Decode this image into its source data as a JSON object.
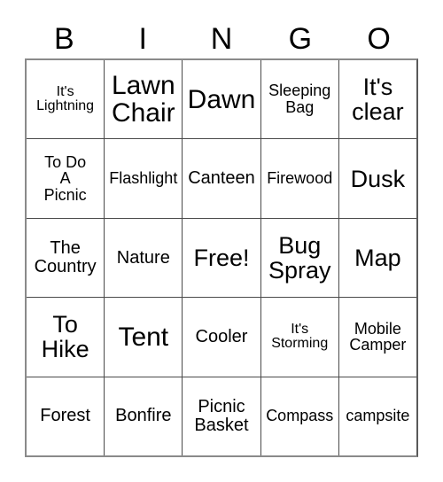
{
  "card": {
    "title_letters": [
      "B",
      "I",
      "N",
      "G",
      "O"
    ],
    "rows": [
      [
        {
          "text": "It's\nLightning",
          "size": "sz-s"
        },
        {
          "text": "Lawn\nChair",
          "size": "sz-xxl"
        },
        {
          "text": "Dawn",
          "size": "sz-xxl"
        },
        {
          "text": "Sleeping\nBag",
          "size": "sz-m"
        },
        {
          "text": "It's\nclear",
          "size": "sz-xl"
        }
      ],
      [
        {
          "text": "To Do\nA\nPicnic",
          "size": "sz-m"
        },
        {
          "text": "Flashlight",
          "size": "sz-m"
        },
        {
          "text": "Canteen",
          "size": "sz-ml"
        },
        {
          "text": "Firewood",
          "size": "sz-m"
        },
        {
          "text": "Dusk",
          "size": "sz-xl"
        }
      ],
      [
        {
          "text": "The\nCountry",
          "size": "sz-ml"
        },
        {
          "text": "Nature",
          "size": "sz-ml"
        },
        {
          "text": "Free!",
          "size": "sz-xl"
        },
        {
          "text": "Bug\nSpray",
          "size": "sz-xl"
        },
        {
          "text": "Map",
          "size": "sz-xl"
        }
      ],
      [
        {
          "text": "To\nHike",
          "size": "sz-xl"
        },
        {
          "text": "Tent",
          "size": "sz-xxl"
        },
        {
          "text": "Cooler",
          "size": "sz-ml"
        },
        {
          "text": "It's\nStorming",
          "size": "sz-s"
        },
        {
          "text": "Mobile\nCamper",
          "size": "sz-m"
        }
      ],
      [
        {
          "text": "Forest",
          "size": "sz-ml"
        },
        {
          "text": "Bonfire",
          "size": "sz-ml"
        },
        {
          "text": "Picnic\nBasket",
          "size": "sz-ml"
        },
        {
          "text": "Compass",
          "size": "sz-m"
        },
        {
          "text": "campsite",
          "size": "sz-m"
        }
      ]
    ]
  },
  "colors": {
    "background": "#ffffff",
    "text": "#000000",
    "grid_line": "#4a4a4a",
    "grid_outer": "#8a8a8a"
  }
}
